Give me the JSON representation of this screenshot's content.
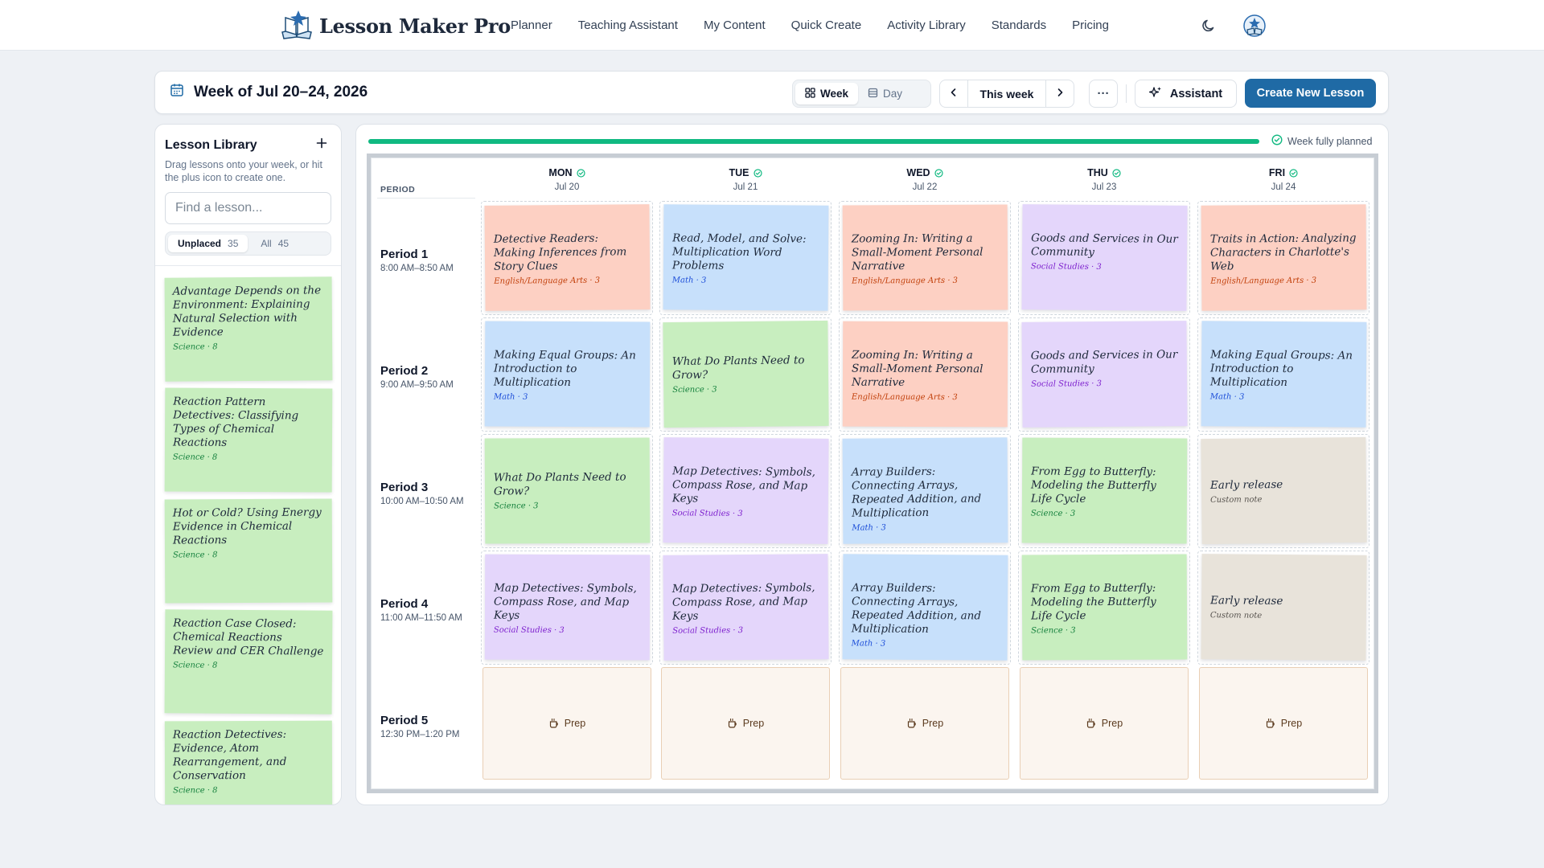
{
  "app": {
    "brand_name": "Lesson Maker Pro",
    "nav": [
      "Planner",
      "Teaching Assistant",
      "My Content",
      "Quick Create",
      "Activity Library",
      "Standards",
      "Pricing"
    ]
  },
  "week": {
    "title": "Week of Jul 20–24, 2026",
    "view_week": "Week",
    "view_day": "Day",
    "this_week": "This week",
    "more": "···",
    "assistant": "Assistant",
    "create": "Create New Lesson"
  },
  "library": {
    "title": "Lesson Library",
    "description": "Drag lessons onto your week, or hit the plus icon to create one.",
    "search_placeholder": "Find a lesson...",
    "tabs": [
      {
        "label": "Unplaced",
        "count": "35"
      },
      {
        "label": "All",
        "count": "45"
      }
    ],
    "items": [
      {
        "title": "Advantage Depends on the Environment: Explaining Natural Selection with Evidence",
        "meta": "Science · 8"
      },
      {
        "title": "Reaction Pattern Detectives: Classifying Types of Chemical Reactions",
        "meta": "Science · 8"
      },
      {
        "title": "Hot or Cold? Using Energy Evidence in Chemical Reactions",
        "meta": "Science · 8"
      },
      {
        "title": "Reaction Case Closed: Chemical Reactions Review and CER Challenge",
        "meta": "Science · 8"
      },
      {
        "title": "Reaction Detectives: Evidence, Atom Rearrangement, and Conservation",
        "meta": "Science · 8"
      }
    ]
  },
  "planner": {
    "progress": 1.0,
    "progress_label": "Week fully planned",
    "period_header": "PERIOD",
    "days": [
      {
        "name": "MON",
        "date": "Jul 20"
      },
      {
        "name": "TUE",
        "date": "Jul 21"
      },
      {
        "name": "WED",
        "date": "Jul 22"
      },
      {
        "name": "THU",
        "date": "Jul 23"
      },
      {
        "name": "FRI",
        "date": "Jul 24"
      }
    ],
    "periods": [
      {
        "name": "Period 1",
        "time": "8:00 AM–8:50 AM"
      },
      {
        "name": "Period 2",
        "time": "9:00 AM–9:50 AM"
      },
      {
        "name": "Period 3",
        "time": "10:00 AM–10:50 AM"
      },
      {
        "name": "Period 4",
        "time": "11:00 AM–11:50 AM"
      },
      {
        "name": "Period 5",
        "time": "12:30 PM–1:20 PM"
      }
    ],
    "grid": [
      [
        {
          "title": "Detective Readers: Making Inferences from Story Clues",
          "meta": "English/Language Arts · 3",
          "subject": "ela"
        },
        {
          "title": "Read, Model, and Solve: Multiplication Word Problems",
          "meta": "Math · 3",
          "subject": "math"
        },
        {
          "title": "Zooming In: Writing a Small-Moment Personal Narrative",
          "meta": "English/Language Arts · 3",
          "subject": "ela"
        },
        {
          "title": "Goods and Services in Our Community",
          "meta": "Social Studies · 3",
          "subject": "ss"
        },
        {
          "title": "Traits in Action: Analyzing Characters in Charlotte's Web",
          "meta": "English/Language Arts · 3",
          "subject": "ela"
        }
      ],
      [
        {
          "title": "Making Equal Groups: An Introduction to Multiplication",
          "meta": "Math · 3",
          "subject": "math"
        },
        {
          "title": "What Do Plants Need to Grow?",
          "meta": "Science · 3",
          "subject": "sci"
        },
        {
          "title": "Zooming In: Writing a Small-Moment Personal Narrative",
          "meta": "English/Language Arts · 3",
          "subject": "ela"
        },
        {
          "title": "Goods and Services in Our Community",
          "meta": "Social Studies · 3",
          "subject": "ss"
        },
        {
          "title": "Making Equal Groups: An Introduction to Multiplication",
          "meta": "Math · 3",
          "subject": "math"
        }
      ],
      [
        {
          "title": "What Do Plants Need to Grow?",
          "meta": "Science · 3",
          "subject": "sci"
        },
        {
          "title": "Map Detectives: Symbols, Compass Rose, and Map Keys",
          "meta": "Social Studies · 3",
          "subject": "ss"
        },
        {
          "title": "Array Builders: Connecting Arrays, Repeated Addition, and Multiplication",
          "meta": "Math · 3",
          "subject": "math"
        },
        {
          "title": "From Egg to Butterfly: Modeling the Butterfly Life Cycle",
          "meta": "Science · 3",
          "subject": "sci"
        },
        {
          "title": "Early release",
          "meta": "Custom note",
          "subject": "custom"
        }
      ],
      [
        {
          "title": "Map Detectives: Symbols, Compass Rose, and Map Keys",
          "meta": "Social Studies · 3",
          "subject": "ss"
        },
        {
          "title": "Map Detectives: Symbols, Compass Rose, and Map Keys",
          "meta": "Social Studies · 3",
          "subject": "ss"
        },
        {
          "title": "Array Builders: Connecting Arrays, Repeated Addition, and Multiplication",
          "meta": "Math · 3",
          "subject": "math"
        },
        {
          "title": "From Egg to Butterfly: Modeling the Butterfly Life Cycle",
          "meta": "Science · 3",
          "subject": "sci"
        },
        {
          "title": "Early release",
          "meta": "Custom note",
          "subject": "custom"
        }
      ],
      [
        {
          "title": "Prep",
          "subject": "prep"
        },
        {
          "title": "Prep",
          "subject": "prep"
        },
        {
          "title": "Prep",
          "subject": "prep"
        },
        {
          "title": "Prep",
          "subject": "prep"
        },
        {
          "title": "Prep",
          "subject": "prep"
        }
      ]
    ]
  },
  "colors": {
    "accent": "#1f6aa5",
    "progress": "#10b981",
    "ela": "#fdd0c3",
    "math": "#c7e0fb",
    "science": "#c8eebf",
    "social_studies": "#e4d6fb",
    "custom": "#e8e3da",
    "prep": "#fbf5ef"
  },
  "icons": {
    "brand": "book-logo-icon",
    "theme": "moon-icon",
    "account": "avatar-logo-icon",
    "calendar": "calendar-icon",
    "week_view": "grid-icon",
    "day_view": "list-icon",
    "assistant": "sparkle-icon",
    "check": "check-circle-icon",
    "prep": "coffee-cup-icon"
  }
}
